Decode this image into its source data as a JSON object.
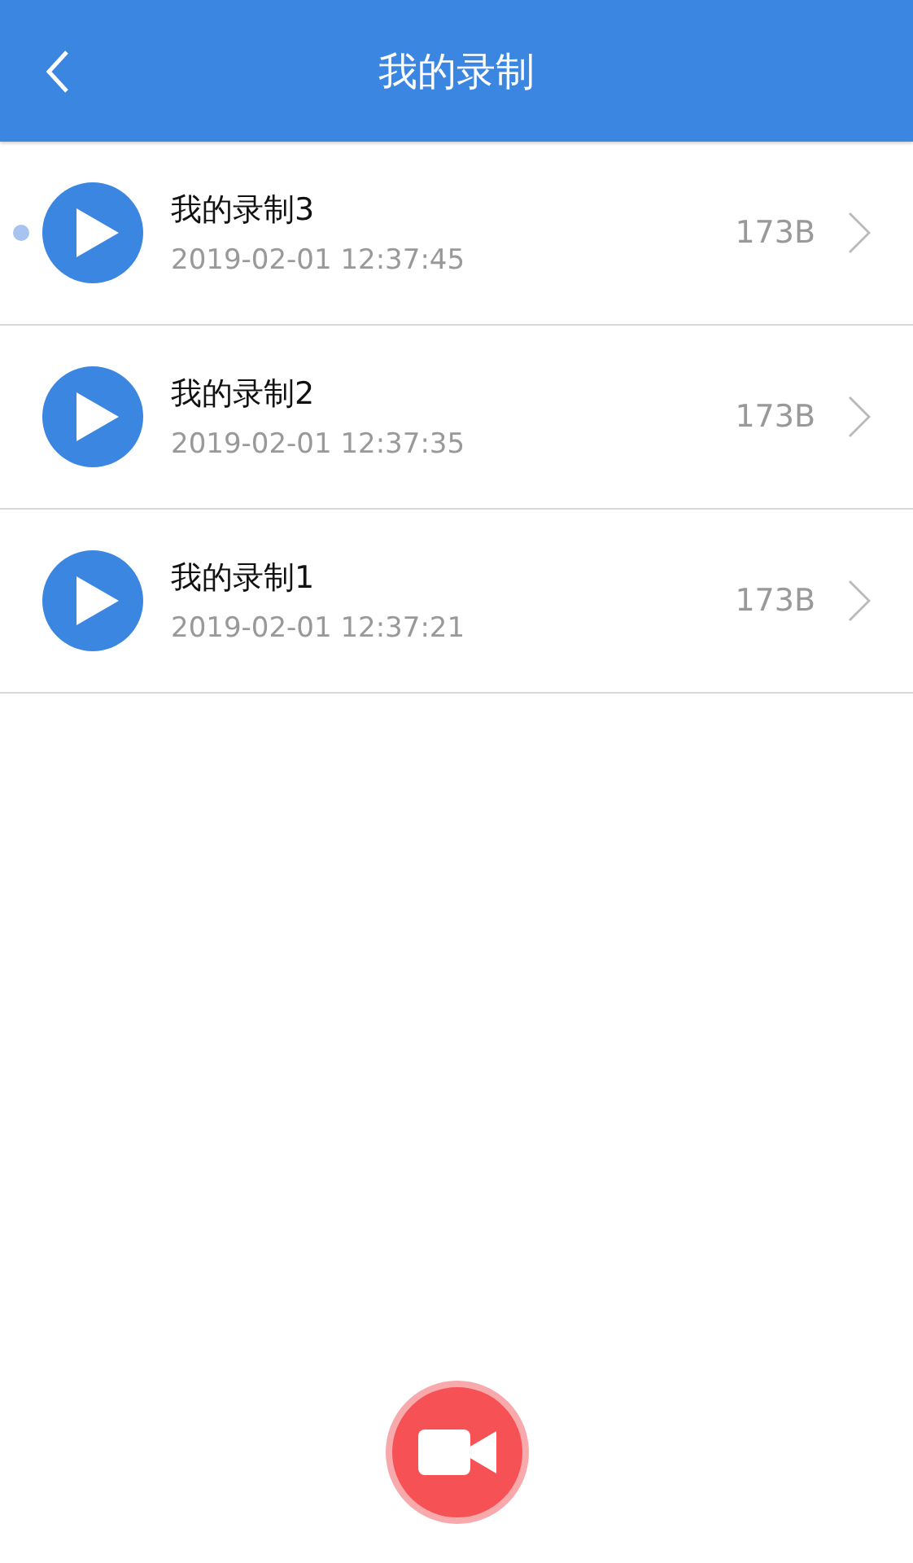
{
  "header": {
    "title": "我的录制"
  },
  "recordings": [
    {
      "name": "我的录制3",
      "time": "2019-02-01 12:37:45",
      "size": "173B",
      "new": true
    },
    {
      "name": "我的录制2",
      "time": "2019-02-01 12:37:35",
      "size": "173B",
      "new": false
    },
    {
      "name": "我的录制1",
      "time": "2019-02-01 12:37:21",
      "size": "173B",
      "new": false
    }
  ]
}
